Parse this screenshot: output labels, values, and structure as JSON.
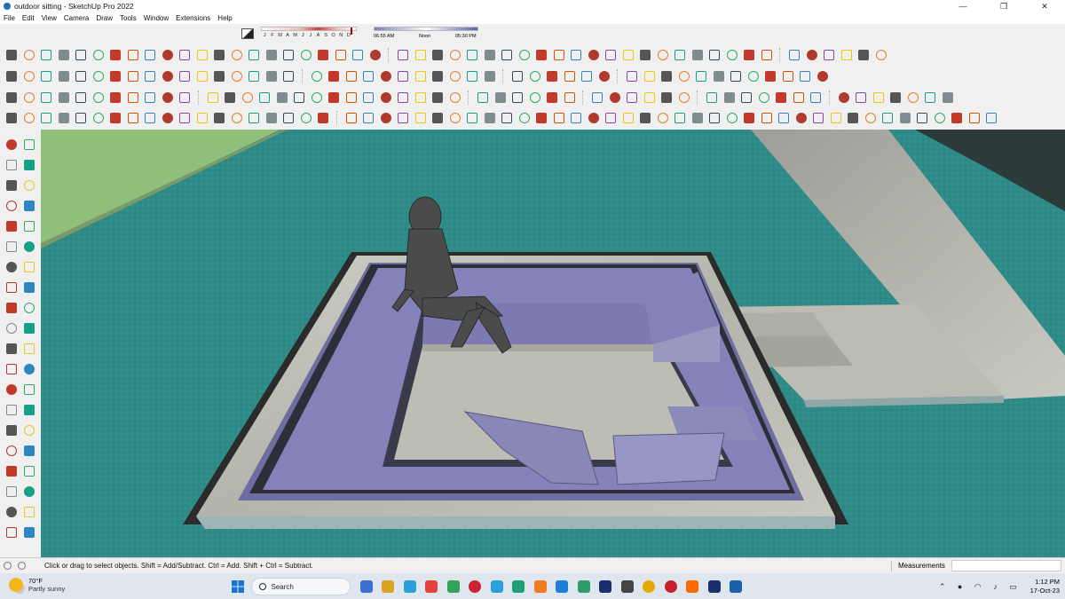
{
  "window": {
    "title": "outdoor sitting - SketchUp Pro 2022",
    "controls": [
      "—",
      "❐",
      "✕"
    ]
  },
  "menu": [
    "File",
    "Edit",
    "View",
    "Camera",
    "Draw",
    "Tools",
    "Window",
    "Extensions",
    "Help"
  ],
  "shadow_settings": {
    "months": [
      "J",
      "F",
      "M",
      "A",
      "M",
      "J",
      "J",
      "A",
      "S",
      "O",
      "N",
      "D"
    ],
    "time_start": "06:55 AM",
    "time_mid": "Noon",
    "time_end": "05:30 PM"
  },
  "status": {
    "hint": "Click or drag to select objects. Shift = Add/Subtract. Ctrl = Add. Shift + Ctrl = Subtract.",
    "measurements_label": "Measurements",
    "measurements_value": ""
  },
  "taskbar": {
    "weather_temp": "70°F",
    "weather_desc": "Partly sunny",
    "search_label": "Search",
    "time": "1:12 PM",
    "date": "17-Oct-23",
    "apps": [
      "file-explorer",
      "mail",
      "video-call",
      "calendar",
      "folder",
      "opera",
      "telegram",
      "notes",
      "brave",
      "vscode",
      "media",
      "photoshop",
      "vector",
      "chrome",
      "pinterest",
      "soundcloud",
      "photoshop-2",
      "sketchup"
    ]
  },
  "colors": {
    "ground": "#2c8a86",
    "grass": "#8fbf7a",
    "pool_interior": "#7a78a8",
    "marble": "#b9b9b2",
    "dark_edge": "#2b2b2b"
  }
}
